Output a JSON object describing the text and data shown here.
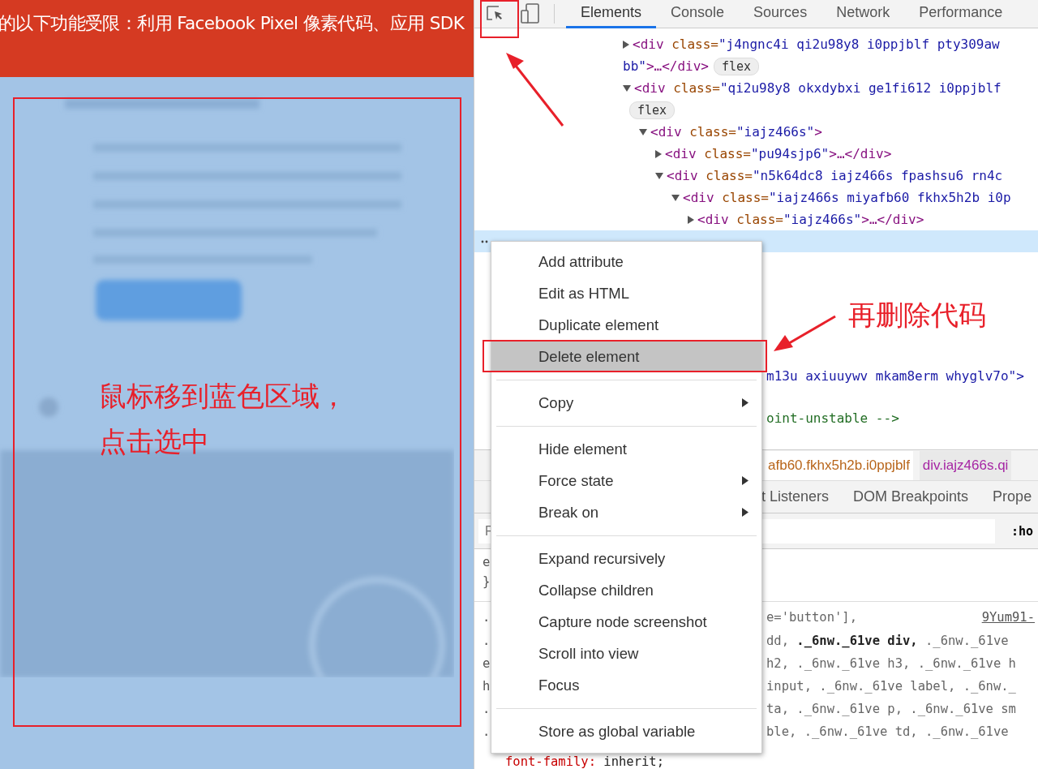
{
  "banner": {
    "text": "的以下功能受限：利用 Facebook Pixel 像素代码、应用 SDK"
  },
  "left_annotation": {
    "lines": [
      "鼠标移到蓝色区域，",
      "点击选中"
    ]
  },
  "devtools": {
    "tabs": [
      {
        "label": "Elements",
        "selected": true
      },
      {
        "label": "Console",
        "selected": false
      },
      {
        "label": "Sources",
        "selected": false
      },
      {
        "label": "Network",
        "selected": false
      },
      {
        "label": "Performance",
        "selected": false
      }
    ],
    "tree": [
      {
        "tag": "<div",
        "attr": "class=",
        "value": "\"j4ngnc4i qi2u98y8 i0ppjblf pty309aw",
        "wrap_value": "bb\"",
        "tail": ">…</div>",
        "badge": "flex",
        "expanded": false,
        "selected": false
      },
      {
        "tag": "<div",
        "attr": "class=",
        "value": "\"qi2u98y8 okxdybxi ge1fi612 i0ppjblf",
        "badge": "flex",
        "expanded": true,
        "selected": false,
        "children": [
          {
            "tag": "<div",
            "attr": "class=",
            "value": "\"iajz466s\"",
            "tail": ">",
            "expanded": true,
            "selected": false,
            "children": [
              {
                "tag": "<div",
                "attr": "class=",
                "value": "\"pu94sjp6\"",
                "tail": ">…</div>",
                "expanded": false,
                "selected": false
              },
              {
                "tag": "<div",
                "attr": "class=",
                "value": "\"n5k64dc8 iajz466s fpashsu6 rn4c",
                "expanded": true,
                "selected": false,
                "children": [
                  {
                    "tag": "<div",
                    "attr": "class=",
                    "value": "\"iajz466s miyafb60 fkhx5h2b i0p",
                    "expanded": true,
                    "selected": false,
                    "children": [
                      {
                        "tag": "<div",
                        "attr": "class=",
                        "value": "\"iajz466s\"",
                        "tail": ">…</div>",
                        "expanded": false,
                        "selected": false
                      },
                      {
                        "selected": true
                      }
                    ]
                  }
                ]
              }
            ]
          }
        ]
      }
    ],
    "fragments": [
      {
        "kind": "code",
        "text": "m13u axiuuywv mkam8erm whyglv7o\">"
      },
      {
        "kind": "comment",
        "text": "oint-unstable -->"
      }
    ],
    "breadcrumbs": [
      {
        "text": "afb60.fkhx5h2b.i0ppjblf",
        "selected": false
      },
      {
        "text": "div.iajz466s.qi",
        "selected": true
      }
    ],
    "subtabs": [
      "t Listeners",
      "DOM Breakpoints",
      "Prope"
    ],
    "filter": {
      "placeholder": "F",
      "suffix": ":ho"
    },
    "style_lines": [
      {
        "lead": "e"
      },
      {
        "lead": "}"
      },
      {
        "lead": ".",
        "text": "e='button'],",
        "link": "9Yum91-"
      },
      {
        "lead": ".",
        "text": "dd, **._6nw._61ve div,** ._6nw._61ve"
      },
      {
        "lead": "e",
        "text": "h2, ._6nw._61ve h3, ._6nw._61ve h"
      },
      {
        "lead": "h",
        "text": "input, ._6nw._61ve label, ._6nw._"
      },
      {
        "lead": ".",
        "text": "ta, ._6nw._61ve p, ._6nw._61ve sm"
      },
      {
        "lead": ".",
        "text": "ble, ._6nw._61ve td, ._6nw._61ve"
      }
    ],
    "declaration": {
      "property": "font-family:",
      "value": "inherit;"
    }
  },
  "context_menu": {
    "items": [
      {
        "kind": "item",
        "label": "Add attribute",
        "submenu": false,
        "selected": false
      },
      {
        "kind": "item",
        "label": "Edit as HTML",
        "submenu": false,
        "selected": false
      },
      {
        "kind": "item",
        "label": "Duplicate element",
        "submenu": false,
        "selected": false
      },
      {
        "kind": "item",
        "label": "Delete element",
        "submenu": false,
        "selected": true
      },
      {
        "kind": "separator"
      },
      {
        "kind": "item",
        "label": "Copy",
        "submenu": true,
        "selected": false
      },
      {
        "kind": "separator"
      },
      {
        "kind": "item",
        "label": "Hide element",
        "submenu": false,
        "selected": false
      },
      {
        "kind": "item",
        "label": "Force state",
        "submenu": true,
        "selected": false
      },
      {
        "kind": "item",
        "label": "Break on",
        "submenu": true,
        "selected": false
      },
      {
        "kind": "separator"
      },
      {
        "kind": "item",
        "label": "Expand recursively",
        "submenu": false,
        "selected": false
      },
      {
        "kind": "item",
        "label": "Collapse children",
        "submenu": false,
        "selected": false
      },
      {
        "kind": "item",
        "label": "Capture node screenshot",
        "submenu": false,
        "selected": false
      },
      {
        "kind": "item",
        "label": "Scroll into view",
        "submenu": false,
        "selected": false
      },
      {
        "kind": "item",
        "label": "Focus",
        "submenu": false,
        "selected": false
      },
      {
        "kind": "separator"
      },
      {
        "kind": "item",
        "label": "Store as global variable",
        "submenu": false,
        "selected": false
      }
    ]
  },
  "right_annotation": {
    "text": "再删除代码"
  }
}
